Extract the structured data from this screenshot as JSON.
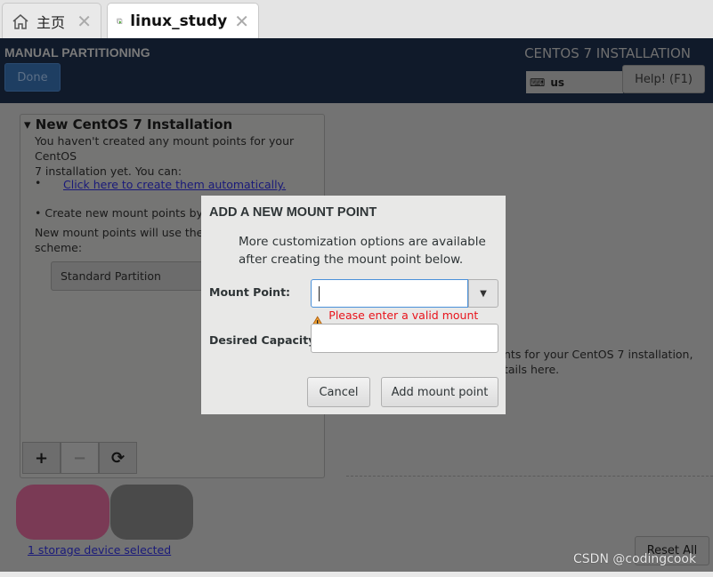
{
  "tabs": [
    {
      "label": "主页",
      "icon": "home-icon"
    },
    {
      "label": "linux_study",
      "icon": "vm-play-icon"
    }
  ],
  "header": {
    "title": "MANUAL PARTITIONING",
    "done": "Done",
    "product": "CENTOS 7 INSTALLATION",
    "keyboard": "us",
    "help": "Help! (F1)"
  },
  "left": {
    "title": "New CentOS 7 Installation",
    "intro1": "You haven't created any mount points for your CentOS",
    "intro2": "7 installation yet.  You can:",
    "bullet": "•",
    "auto_link": "Click here to create them automatically.",
    "create": "•  Create new mount points by c",
    "scheme1": "New mount points will use the f",
    "scheme2": "scheme:",
    "scheme_value": "Standard Partition",
    "add": "+",
    "remove": "−",
    "refresh": "⟳",
    "storage_link": "1 storage device selected"
  },
  "right": {
    "line1": "nts for your CentOS 7 installation,",
    "line2": "tails here.",
    "reset": "Reset All"
  },
  "dialog": {
    "title": "ADD A NEW MOUNT POINT",
    "desc1": "More customization options are available",
    "desc2": "after creating the mount point below.",
    "mount_label": "Mount Point:",
    "mount_value": "",
    "error": "Please enter a valid mount point.",
    "capacity_label": "Desired Capacity:",
    "capacity_value": "",
    "cancel": "Cancel",
    "add": "Add mount point"
  },
  "watermark": "CSDN @codingcook"
}
